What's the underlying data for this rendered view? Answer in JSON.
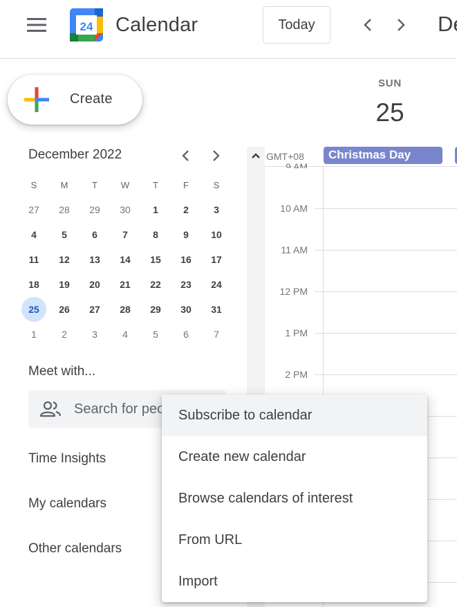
{
  "header": {
    "app_title": "Calendar",
    "logo_number": "24",
    "today_label": "Today",
    "date_partial": "De"
  },
  "create": {
    "label": "Create"
  },
  "mini_calendar": {
    "month_title": "December 2022",
    "weekdays": [
      "S",
      "M",
      "T",
      "W",
      "T",
      "F",
      "S"
    ],
    "weeks": [
      [
        "27",
        "28",
        "29",
        "30",
        "1",
        "2",
        "3"
      ],
      [
        "4",
        "5",
        "6",
        "7",
        "8",
        "9",
        "10"
      ],
      [
        "11",
        "12",
        "13",
        "14",
        "15",
        "16",
        "17"
      ],
      [
        "18",
        "19",
        "20",
        "21",
        "22",
        "23",
        "24"
      ],
      [
        "25",
        "26",
        "27",
        "28",
        "29",
        "30",
        "31"
      ],
      [
        "1",
        "2",
        "3",
        "4",
        "5",
        "6",
        "7"
      ]
    ],
    "today": "25"
  },
  "sidebar": {
    "meet_title": "Meet with...",
    "search_placeholder": "Search for people",
    "time_insights": "Time Insights",
    "my_calendars": "My calendars",
    "other_calendars": "Other calendars"
  },
  "day_view": {
    "day_name": "SUN",
    "day_number": "25",
    "timezone": "GMT+08",
    "allday_event": "Christmas Day",
    "hours": [
      "9 AM",
      "10 AM",
      "11 AM",
      "12 PM",
      "1 PM",
      "2 PM"
    ]
  },
  "menu": {
    "items": [
      "Subscribe to calendar",
      "Create new calendar",
      "Browse calendars of interest",
      "From URL",
      "Import"
    ]
  },
  "colors": {
    "event": "#7986cb",
    "today_highlight": "#d2e3fc",
    "today_text": "#185abc"
  }
}
